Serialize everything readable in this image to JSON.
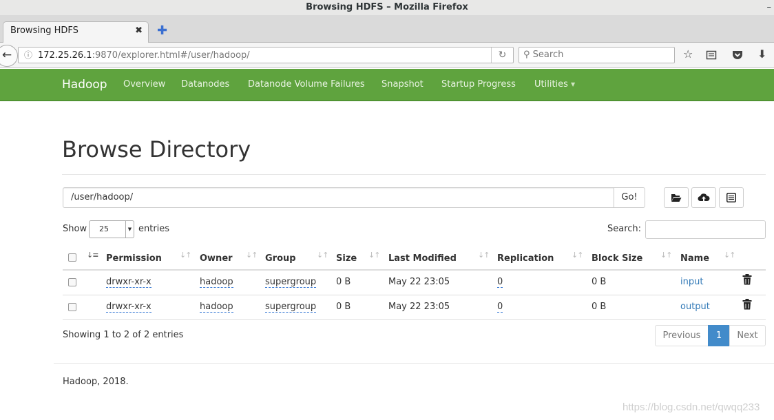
{
  "window": {
    "title": "Browsing HDFS – Mozilla Firefox",
    "min_glyph": "–"
  },
  "browser": {
    "tab_title": "Browsing HDFS",
    "tab_close": "✖",
    "newtab": "✚",
    "back": "←",
    "url_host": "172.25.26.1",
    "url_rest": ":9870/explorer.html#/user/hadoop/",
    "reload": "↻",
    "search_placeholder": "Search",
    "info_glyph": "ⓘ",
    "search_glyph": "⚲"
  },
  "nav": {
    "brand": "Hadoop",
    "items": [
      "Overview",
      "Datanodes",
      "Datanode Volume Failures",
      "Snapshot",
      "Startup Progress",
      "Utilities"
    ],
    "caret": "▼"
  },
  "page": {
    "title": "Browse Directory",
    "dir_path": "/user/hadoop/",
    "go": "Go!",
    "show": "Show",
    "entries_value": "25",
    "entries": "entries",
    "search_label": "Search:",
    "showing": "Showing 1 to 2 of 2 entries",
    "footer": "Hadoop, 2018.",
    "watermark": "https://blog.csdn.net/qwqq233"
  },
  "table": {
    "columns": [
      "Permission",
      "Owner",
      "Group",
      "Size",
      "Last Modified",
      "Replication",
      "Block Size",
      "Name"
    ],
    "rows": [
      {
        "permission": "drwxr-xr-x",
        "owner": "hadoop",
        "group": "supergroup",
        "size": "0 B",
        "modified": "May 22 23:05",
        "replication": "0",
        "block_size": "0 B",
        "name": "input"
      },
      {
        "permission": "drwxr-xr-x",
        "owner": "hadoop",
        "group": "supergroup",
        "size": "0 B",
        "modified": "May 22 23:05",
        "replication": "0",
        "block_size": "0 B",
        "name": "output"
      }
    ]
  },
  "pagination": {
    "previous": "Previous",
    "current": "1",
    "next": "Next"
  },
  "icons": {
    "folder": "folder-open-icon",
    "upload": "cloud-upload-icon",
    "list": "list-alt-icon",
    "trash": "trash-icon",
    "sort": "sort-icon"
  },
  "colors": {
    "nav_green": "#5fa33e",
    "link_blue": "#337ab7",
    "pager_active": "#428bca"
  }
}
